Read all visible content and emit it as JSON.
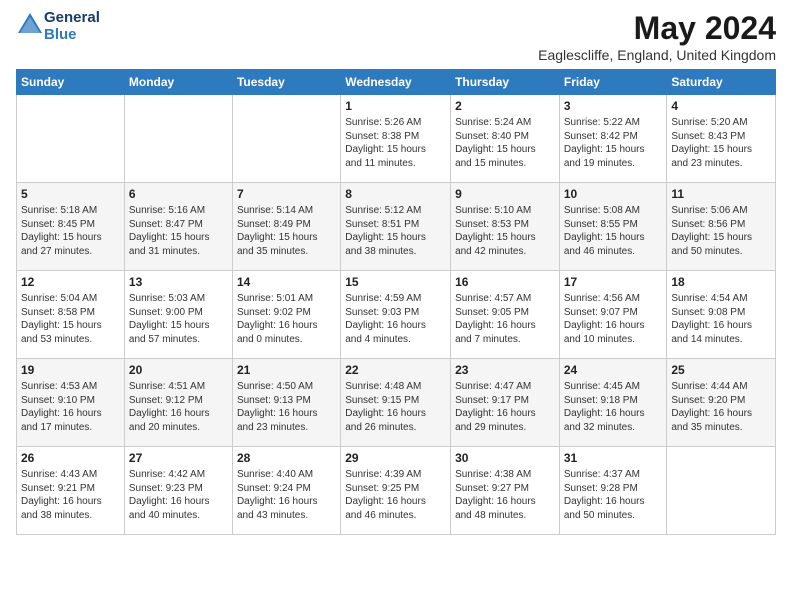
{
  "header": {
    "logo_line1": "General",
    "logo_line2": "Blue",
    "month_year": "May 2024",
    "location": "Eaglescliffe, England, United Kingdom"
  },
  "days_of_week": [
    "Sunday",
    "Monday",
    "Tuesday",
    "Wednesday",
    "Thursday",
    "Friday",
    "Saturday"
  ],
  "weeks": [
    [
      {
        "day": "",
        "info": ""
      },
      {
        "day": "",
        "info": ""
      },
      {
        "day": "",
        "info": ""
      },
      {
        "day": "1",
        "info": "Sunrise: 5:26 AM\nSunset: 8:38 PM\nDaylight: 15 hours\nand 11 minutes."
      },
      {
        "day": "2",
        "info": "Sunrise: 5:24 AM\nSunset: 8:40 PM\nDaylight: 15 hours\nand 15 minutes."
      },
      {
        "day": "3",
        "info": "Sunrise: 5:22 AM\nSunset: 8:42 PM\nDaylight: 15 hours\nand 19 minutes."
      },
      {
        "day": "4",
        "info": "Sunrise: 5:20 AM\nSunset: 8:43 PM\nDaylight: 15 hours\nand 23 minutes."
      }
    ],
    [
      {
        "day": "5",
        "info": "Sunrise: 5:18 AM\nSunset: 8:45 PM\nDaylight: 15 hours\nand 27 minutes."
      },
      {
        "day": "6",
        "info": "Sunrise: 5:16 AM\nSunset: 8:47 PM\nDaylight: 15 hours\nand 31 minutes."
      },
      {
        "day": "7",
        "info": "Sunrise: 5:14 AM\nSunset: 8:49 PM\nDaylight: 15 hours\nand 35 minutes."
      },
      {
        "day": "8",
        "info": "Sunrise: 5:12 AM\nSunset: 8:51 PM\nDaylight: 15 hours\nand 38 minutes."
      },
      {
        "day": "9",
        "info": "Sunrise: 5:10 AM\nSunset: 8:53 PM\nDaylight: 15 hours\nand 42 minutes."
      },
      {
        "day": "10",
        "info": "Sunrise: 5:08 AM\nSunset: 8:55 PM\nDaylight: 15 hours\nand 46 minutes."
      },
      {
        "day": "11",
        "info": "Sunrise: 5:06 AM\nSunset: 8:56 PM\nDaylight: 15 hours\nand 50 minutes."
      }
    ],
    [
      {
        "day": "12",
        "info": "Sunrise: 5:04 AM\nSunset: 8:58 PM\nDaylight: 15 hours\nand 53 minutes."
      },
      {
        "day": "13",
        "info": "Sunrise: 5:03 AM\nSunset: 9:00 PM\nDaylight: 15 hours\nand 57 minutes."
      },
      {
        "day": "14",
        "info": "Sunrise: 5:01 AM\nSunset: 9:02 PM\nDaylight: 16 hours\nand 0 minutes."
      },
      {
        "day": "15",
        "info": "Sunrise: 4:59 AM\nSunset: 9:03 PM\nDaylight: 16 hours\nand 4 minutes."
      },
      {
        "day": "16",
        "info": "Sunrise: 4:57 AM\nSunset: 9:05 PM\nDaylight: 16 hours\nand 7 minutes."
      },
      {
        "day": "17",
        "info": "Sunrise: 4:56 AM\nSunset: 9:07 PM\nDaylight: 16 hours\nand 10 minutes."
      },
      {
        "day": "18",
        "info": "Sunrise: 4:54 AM\nSunset: 9:08 PM\nDaylight: 16 hours\nand 14 minutes."
      }
    ],
    [
      {
        "day": "19",
        "info": "Sunrise: 4:53 AM\nSunset: 9:10 PM\nDaylight: 16 hours\nand 17 minutes."
      },
      {
        "day": "20",
        "info": "Sunrise: 4:51 AM\nSunset: 9:12 PM\nDaylight: 16 hours\nand 20 minutes."
      },
      {
        "day": "21",
        "info": "Sunrise: 4:50 AM\nSunset: 9:13 PM\nDaylight: 16 hours\nand 23 minutes."
      },
      {
        "day": "22",
        "info": "Sunrise: 4:48 AM\nSunset: 9:15 PM\nDaylight: 16 hours\nand 26 minutes."
      },
      {
        "day": "23",
        "info": "Sunrise: 4:47 AM\nSunset: 9:17 PM\nDaylight: 16 hours\nand 29 minutes."
      },
      {
        "day": "24",
        "info": "Sunrise: 4:45 AM\nSunset: 9:18 PM\nDaylight: 16 hours\nand 32 minutes."
      },
      {
        "day": "25",
        "info": "Sunrise: 4:44 AM\nSunset: 9:20 PM\nDaylight: 16 hours\nand 35 minutes."
      }
    ],
    [
      {
        "day": "26",
        "info": "Sunrise: 4:43 AM\nSunset: 9:21 PM\nDaylight: 16 hours\nand 38 minutes."
      },
      {
        "day": "27",
        "info": "Sunrise: 4:42 AM\nSunset: 9:23 PM\nDaylight: 16 hours\nand 40 minutes."
      },
      {
        "day": "28",
        "info": "Sunrise: 4:40 AM\nSunset: 9:24 PM\nDaylight: 16 hours\nand 43 minutes."
      },
      {
        "day": "29",
        "info": "Sunrise: 4:39 AM\nSunset: 9:25 PM\nDaylight: 16 hours\nand 46 minutes."
      },
      {
        "day": "30",
        "info": "Sunrise: 4:38 AM\nSunset: 9:27 PM\nDaylight: 16 hours\nand 48 minutes."
      },
      {
        "day": "31",
        "info": "Sunrise: 4:37 AM\nSunset: 9:28 PM\nDaylight: 16 hours\nand 50 minutes."
      },
      {
        "day": "",
        "info": ""
      }
    ]
  ]
}
